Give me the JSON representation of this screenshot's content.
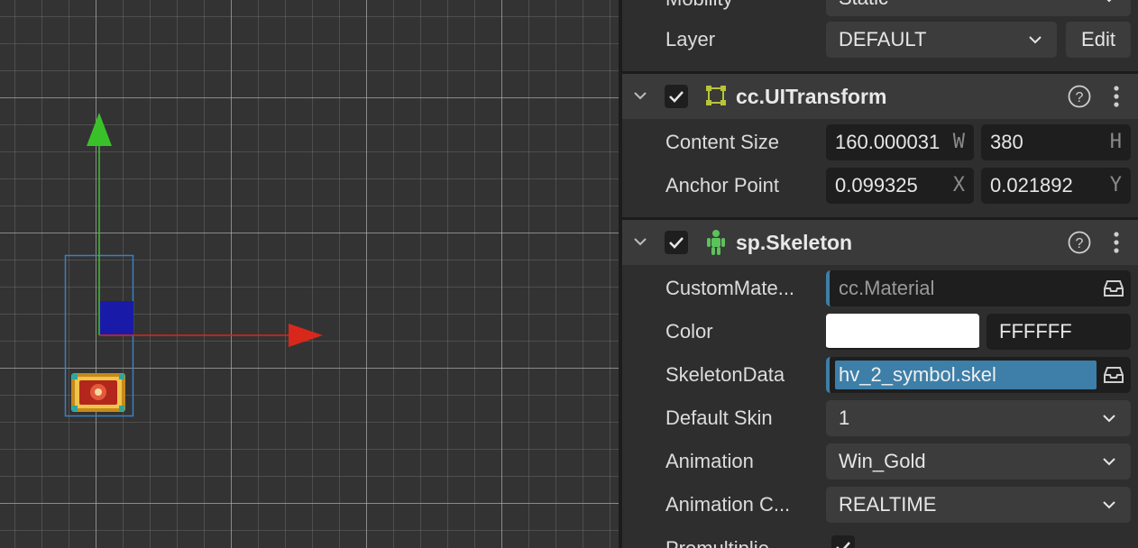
{
  "inspector": {
    "mobility": {
      "label": "Mobility",
      "value": "Static"
    },
    "layer": {
      "label": "Layer",
      "value": "DEFAULT",
      "edit_label": "Edit"
    },
    "ui_transform": {
      "title": "cc.UITransform",
      "content_size": {
        "label": "Content Size",
        "w": "160.000031",
        "w_axis": "W",
        "h": "380",
        "h_axis": "H"
      },
      "anchor_point": {
        "label": "Anchor Point",
        "x": "0.099325",
        "x_axis": "X",
        "y": "0.021892",
        "y_axis": "Y"
      }
    },
    "skeleton": {
      "title": "sp.Skeleton",
      "custom_material": {
        "label": "CustomMate...",
        "value": "cc.Material"
      },
      "color": {
        "label": "Color",
        "swatch": "#FFFFFF",
        "hex": "FFFFFF"
      },
      "skeleton_data": {
        "label": "SkeletonData",
        "value": "hv_2_symbol.skel"
      },
      "default_skin": {
        "label": "Default Skin",
        "value": "1"
      },
      "animation": {
        "label": "Animation",
        "value": "Win_Gold"
      },
      "animation_cache": {
        "label": "Animation C...",
        "value": "REALTIME"
      },
      "premultiplied": {
        "label": "Premultiplie",
        "checked": true
      }
    }
  },
  "colors": {
    "gizmo_y": "#39c12a",
    "gizmo_x": "#d8281c",
    "gizmo_z": "#1a1aa8",
    "selection": "#3d7fa8",
    "ui_transform_icon": "#b8c43a",
    "skeleton_icon": "#5cc25c"
  }
}
